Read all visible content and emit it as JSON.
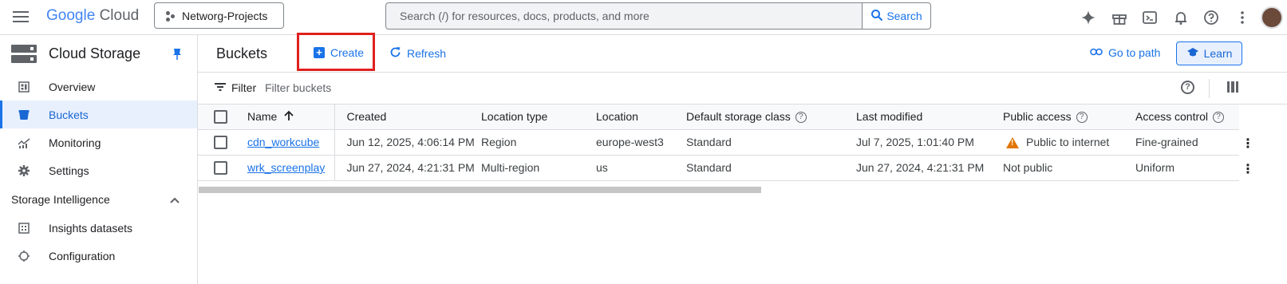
{
  "header": {
    "logo_google": "Google",
    "logo_cloud": "Cloud",
    "project": "Networg-Projects",
    "search_placeholder": "Search (/) for resources, docs, products, and more",
    "search_button": "Search"
  },
  "sidebar": {
    "title": "Cloud Storage",
    "items": [
      {
        "label": "Overview",
        "icon": "overview-icon"
      },
      {
        "label": "Buckets",
        "icon": "bucket-icon",
        "active": true
      },
      {
        "label": "Monitoring",
        "icon": "monitoring-icon"
      },
      {
        "label": "Settings",
        "icon": "gear-icon"
      }
    ],
    "section_title": "Storage Intelligence",
    "section_items": [
      {
        "label": "Insights datasets",
        "icon": "dataset-icon"
      },
      {
        "label": "Configuration",
        "icon": "config-icon"
      }
    ]
  },
  "main": {
    "title": "Buckets",
    "create_label": "Create",
    "refresh_label": "Refresh",
    "go_to_path_label": "Go to path",
    "learn_label": "Learn",
    "filter_label": "Filter",
    "filter_placeholder": "Filter buckets"
  },
  "table": {
    "columns": [
      "Name",
      "Created",
      "Location type",
      "Location",
      "Default storage class",
      "Last modified",
      "Public access",
      "Access control"
    ],
    "rows": [
      {
        "name": "cdn_workcube",
        "created": "Jun 12, 2025, 4:06:14 PM",
        "location_type": "Region",
        "location": "europe-west3",
        "storage_class": "Standard",
        "last_modified": "Jul 7, 2025, 1:01:40 PM",
        "public_access": "Public to internet",
        "access_control": "Fine-grained"
      },
      {
        "name": "wrk_screenplay",
        "created": "Jun 27, 2024, 4:21:31 PM",
        "location_type": "Multi-region",
        "location": "us",
        "storage_class": "Standard",
        "last_modified": "Jun 27, 2024, 4:21:31 PM",
        "public_access": "Not public",
        "access_control": "Uniform"
      }
    ]
  },
  "colors": {
    "accent": "#1a73e8",
    "highlight_box": "#e0201e",
    "warning": "#e37400"
  }
}
